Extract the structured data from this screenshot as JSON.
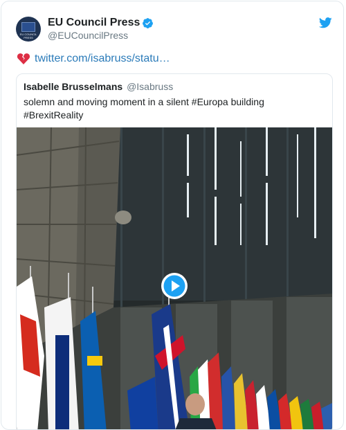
{
  "tweet": {
    "author_name": "EU Council Press",
    "author_handle": "@EUCouncilPress",
    "avatar_text": "EU COUNCIL PRESS",
    "heart_icon": "broken-heart-icon",
    "link_text": "twitter.com/isabruss/statu…",
    "verified_icon": "verified-badge-icon",
    "brand_icon": "twitter-bird-icon"
  },
  "quoted": {
    "author_name": "Isabelle Brusselmans",
    "author_handle": "@Isabruss",
    "text": "solemn and moving moment in a silent #Europa building #BrexitReality",
    "media": {
      "kind": "video",
      "description_icon": "play-button-icon"
    }
  },
  "colors": {
    "link": "#2b7bb9",
    "verified": "#1da1f2",
    "secondary_text": "#697882",
    "border": "#e1e8ed"
  }
}
